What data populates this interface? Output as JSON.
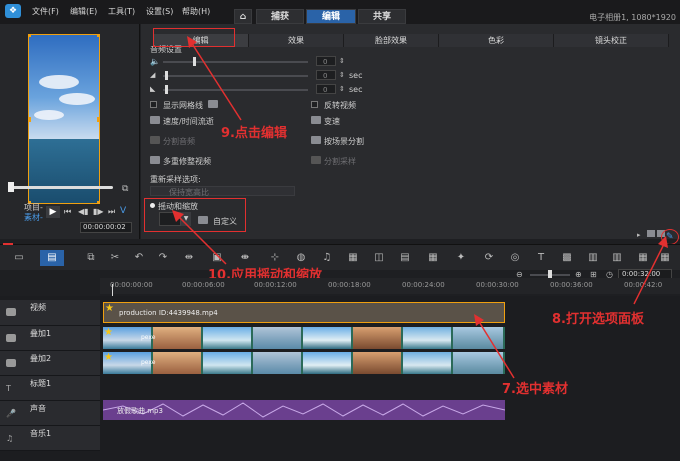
{
  "menu": {
    "items": [
      "文件(F)",
      "编辑(E)",
      "工具(T)",
      "设置(S)",
      "帮助(H)"
    ]
  },
  "tabs": [
    "捕获",
    "编辑",
    "共享"
  ],
  "project_info": "电子相册1, 1080*1920",
  "preview": {
    "project_label": "项目-",
    "clip_label": "素材-",
    "timecode": "00:00:00:02"
  },
  "settings": {
    "subtabs": [
      "编辑",
      "效果",
      "脸部效果",
      "色彩",
      "镜头校正"
    ],
    "audio_section_title": "音频设置",
    "sec_label": "sec",
    "values": [
      "0",
      "0",
      "0"
    ],
    "options": {
      "show_grid": "显示网格线",
      "reverse_video": "反转视频",
      "speed_time": "速度/时间流逝",
      "speed_change": "变速",
      "split_audio": "分割音频",
      "scene_split": "按场景分割",
      "multi_trim": "多重修整视频",
      "split_sampling": "分割采样",
      "resample_title": "重新采样选项:",
      "keep_aspect": "保持宽高比",
      "pan_zoom": "摇动和缩放",
      "custom": "自定义"
    }
  },
  "annotations": {
    "step8": "8.打开选项面板",
    "step9": "9.点击编辑",
    "step10": "10.应用摇动和缩放",
    "step7": "7.选中素材"
  },
  "ruler": {
    "ticks": [
      "00:00:00:00",
      "00:00:06:00",
      "00:00:12:00",
      "00:00:18:00",
      "00:00:24:00",
      "00:00:30:00",
      "00:00:36:00",
      "00:00:42:0"
    ],
    "zoom_time": "0:00:32:00"
  },
  "tracks": [
    {
      "name": "视频"
    },
    {
      "name": "叠加1"
    },
    {
      "name": "叠加2"
    },
    {
      "name": "标题1"
    },
    {
      "name": "声音"
    },
    {
      "name": "音乐1"
    }
  ],
  "clips": {
    "video_clip_label": "production ID:4439948.mp4",
    "audio_clip_label": "放假歌曲.mp3",
    "overlay_label": "pexe"
  },
  "colors": {
    "accent_blue": "#2a63a8",
    "clip_border": "#f0a010",
    "annotation_red": "#e23030",
    "audio_purple": "#6a3f8e"
  }
}
